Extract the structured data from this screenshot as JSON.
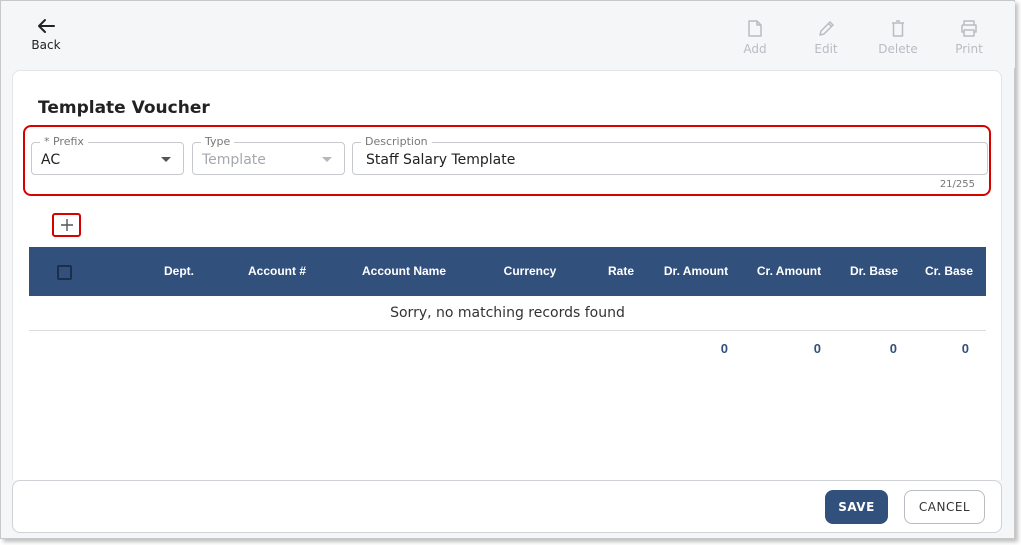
{
  "toolbar": {
    "back_label": "Back",
    "back_icon": "arrow-left-icon",
    "actions": [
      {
        "label": "Add",
        "icon": "file-icon",
        "enabled": false
      },
      {
        "label": "Edit",
        "icon": "pencil-icon",
        "enabled": false
      },
      {
        "label": "Delete",
        "icon": "trash-icon",
        "enabled": false
      },
      {
        "label": "Print",
        "icon": "printer-icon",
        "enabled": false
      }
    ]
  },
  "form": {
    "title": "Template Voucher",
    "prefix": {
      "label": "* Prefix",
      "value": "AC"
    },
    "type": {
      "label": "Type",
      "value": "Template",
      "disabled": true
    },
    "description": {
      "label": "Description",
      "value": "Staff Salary Template",
      "counter": "21/255"
    }
  },
  "grid": {
    "add_row_icon": "plus-icon",
    "columns": [
      "Dept.",
      "Account #",
      "Account Name",
      "Currency",
      "Rate",
      "Dr. Amount",
      "Cr. Amount",
      "Dr. Base",
      "Cr. Base"
    ],
    "empty_message": "Sorry, no matching records found",
    "totals": {
      "dr_amount": "0",
      "cr_amount": "0",
      "dr_base": "0",
      "cr_base": "0"
    }
  },
  "footer": {
    "save_label": "SAVE",
    "cancel_label": "CANCEL"
  },
  "colors": {
    "primary": "#32507c",
    "highlight": "#d90000",
    "disabled": "#b9bcc2"
  }
}
